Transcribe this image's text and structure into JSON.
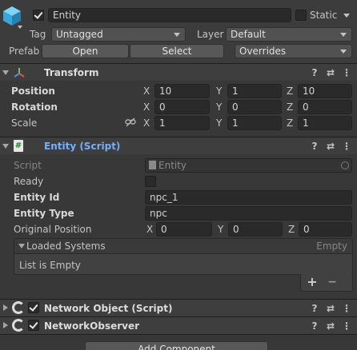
{
  "gameobject": {
    "active": true,
    "name": "Entity",
    "static_label": "Static",
    "static_checked": false,
    "tag_label": "Tag",
    "tag_value": "Untagged",
    "layer_label": "Layer",
    "layer_value": "Default",
    "prefab_label": "Prefab",
    "open_label": "Open",
    "select_label": "Select",
    "overrides_label": "Overrides"
  },
  "transform": {
    "title": "Transform",
    "position_label": "Position",
    "rotation_label": "Rotation",
    "scale_label": "Scale",
    "x": "X",
    "y": "Y",
    "z": "Z",
    "position": {
      "x": "10",
      "y": "1",
      "z": "10"
    },
    "rotation": {
      "x": "0",
      "y": "0",
      "z": "0"
    },
    "scale": {
      "x": "1",
      "y": "1",
      "z": "1"
    }
  },
  "entity_script": {
    "title": "Entity (Script)",
    "script_label": "Script",
    "script_value": "Entity",
    "ready_label": "Ready",
    "ready_checked": false,
    "entity_id_label": "Entity Id",
    "entity_id_value": "npc_1",
    "entity_type_label": "Entity Type",
    "entity_type_value": "npc",
    "original_position_label": "Original Position",
    "original_position": {
      "x": "0",
      "y": "0",
      "z": "0"
    },
    "loaded_systems_label": "Loaded Systems",
    "loaded_systems_state": "Empty",
    "list_empty_text": "List is Empty",
    "add_glyph": "+",
    "remove_glyph": "−"
  },
  "components": [
    {
      "title": "Network Object (Script)",
      "enabled": true
    },
    {
      "title": "NetworkObserver",
      "enabled": true
    }
  ],
  "add_component_label": "Add Component",
  "icons": {
    "help": "?",
    "presets": "⇄",
    "menu": "⋮"
  }
}
